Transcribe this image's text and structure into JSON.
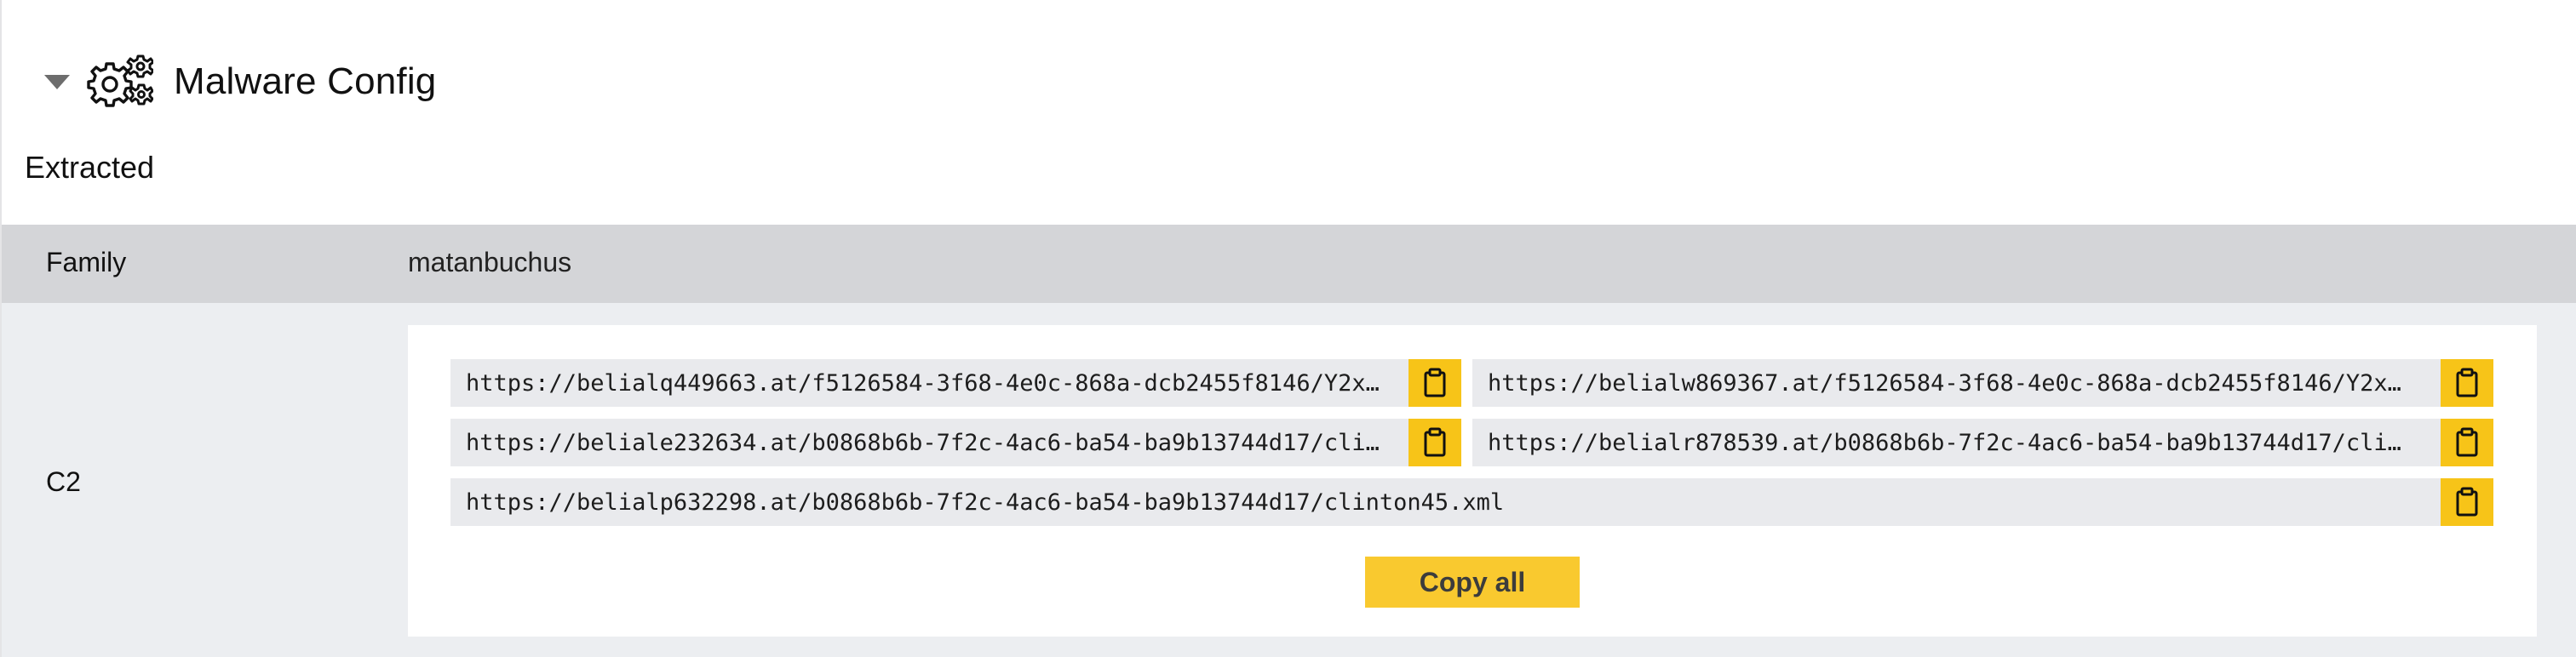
{
  "section": {
    "title": "Malware Config",
    "icon": "gears-icon"
  },
  "subheading": "Extracted",
  "rows": {
    "family": {
      "label": "Family",
      "value": "matanbuchus"
    },
    "c2": {
      "label": "C2",
      "urls": [
        "https://belialq449663.at/f5126584-3f68-4e0c-868a-dcb2455f8146/Y2x…",
        "https://belialw869367.at/f5126584-3f68-4e0c-868a-dcb2455f8146/Y2x…",
        "https://beliale232634.at/b0868b6b-7f2c-4ac6-ba54-ba9b13744d17/cli…",
        "https://belialr878539.at/b0868b6b-7f2c-4ac6-ba54-ba9b13744d17/cli…",
        "https://belialp632298.at/b0868b6b-7f2c-4ac6-ba54-ba9b13744d17/clinton45.xml"
      ],
      "copy_all_label": "Copy all"
    }
  },
  "colors": {
    "accent": "#f7c418",
    "row_family_bg": "#d4d5d8",
    "row_c2_bg": "#eceef1",
    "url_box_bg": "#e9eaed"
  }
}
